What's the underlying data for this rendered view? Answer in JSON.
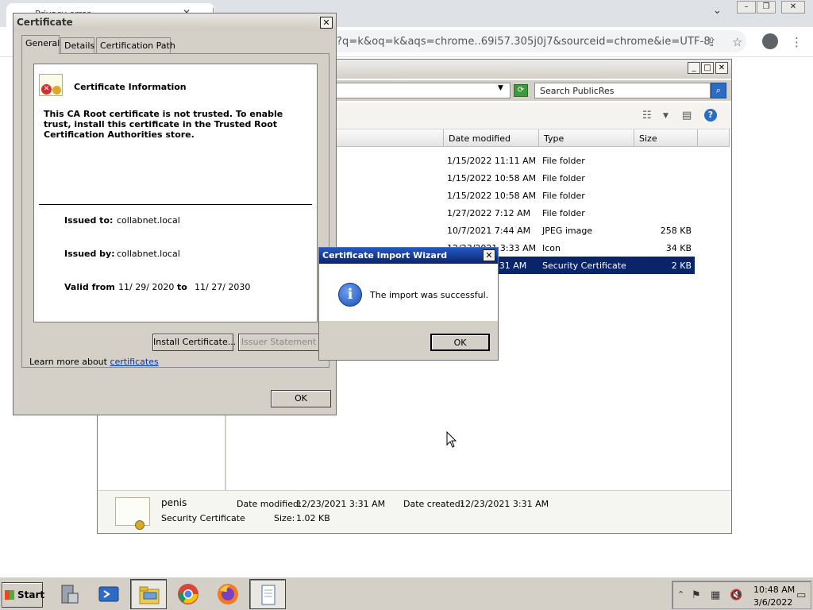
{
  "browser": {
    "tab_title": "Privacy error",
    "url": "?q=k&oq=k&aqs=chrome..69i57.305j0j7&sourceid=chrome&ie=UTF-8"
  },
  "explorer": {
    "search_placeholder": "Search PublicRes",
    "columns": [
      "Date modified",
      "Type",
      "Size"
    ],
    "rows": [
      {
        "date": "1/15/2022 11:11 AM",
        "type": "File folder",
        "size": ""
      },
      {
        "date": "1/15/2022 10:58 AM",
        "type": "File folder",
        "size": ""
      },
      {
        "date": "1/15/2022 10:58 AM",
        "type": "File folder",
        "size": ""
      },
      {
        "date": "1/27/2022 7:12 AM",
        "type": "File folder",
        "size": ""
      },
      {
        "date": "10/7/2021 7:44 AM",
        "type": "JPEG image",
        "size": "258 KB"
      },
      {
        "date": "12/23/2021 3:33 AM",
        "type": "Icon",
        "size": "34 KB"
      },
      {
        "date": ":31 AM",
        "type": "Security Certificate",
        "size": "2 KB"
      }
    ],
    "details": {
      "name": "penis",
      "type": "Security Certificate",
      "date_modified_label": "Date modified:",
      "date_modified": "12/23/2021 3:31 AM",
      "date_created_label": "Date created:",
      "date_created": "12/23/2021 3:31 AM",
      "size_label": "Size:",
      "size": "1.02 KB"
    }
  },
  "certificate": {
    "title": "Certificate",
    "tabs": [
      "General",
      "Details",
      "Certification Path"
    ],
    "heading": "Certificate Information",
    "warning": "This CA Root certificate is not trusted. To enable trust, install this certificate in the Trusted Root Certification Authorities store.",
    "issued_to_label": "Issued to:",
    "issued_to": "collabnet.local",
    "issued_by_label": "Issued by:",
    "issued_by": "collabnet.local",
    "valid_from_label": "Valid from",
    "valid_from": "11/ 29/ 2020",
    "to_label": "to",
    "valid_to": "11/ 27/ 2030",
    "install_button": "Install Certificate...",
    "issuer_button": "Issuer Statement",
    "learn_prefix": "Learn more about ",
    "learn_link": "certificates",
    "ok_button": "OK"
  },
  "wizard": {
    "title": "Certificate Import Wizard",
    "message": "The import was successful.",
    "ok_button": "OK"
  },
  "taskbar": {
    "start_label": "Start",
    "clock_time": "10:48 AM",
    "clock_date": "3/6/2022"
  }
}
